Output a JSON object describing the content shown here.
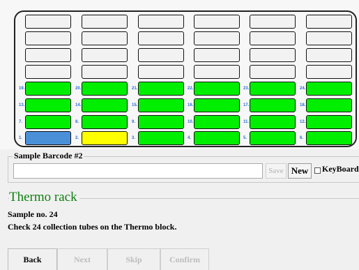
{
  "rack": {
    "slots": [
      {
        "num": "",
        "state": "empty"
      },
      {
        "num": "",
        "state": "empty"
      },
      {
        "num": "",
        "state": "empty"
      },
      {
        "num": "",
        "state": "empty"
      },
      {
        "num": "",
        "state": "empty"
      },
      {
        "num": "",
        "state": "empty"
      },
      {
        "num": "",
        "state": "empty"
      },
      {
        "num": "",
        "state": "empty"
      },
      {
        "num": "",
        "state": "empty"
      },
      {
        "num": "",
        "state": "empty"
      },
      {
        "num": "",
        "state": "empty"
      },
      {
        "num": "",
        "state": "empty"
      },
      {
        "num": "",
        "state": "empty"
      },
      {
        "num": "",
        "state": "empty"
      },
      {
        "num": "",
        "state": "empty"
      },
      {
        "num": "",
        "state": "empty"
      },
      {
        "num": "",
        "state": "empty"
      },
      {
        "num": "",
        "state": "empty"
      },
      {
        "num": "",
        "state": "empty"
      },
      {
        "num": "",
        "state": "empty"
      },
      {
        "num": "",
        "state": "empty"
      },
      {
        "num": "",
        "state": "empty"
      },
      {
        "num": "",
        "state": "empty"
      },
      {
        "num": "",
        "state": "empty"
      },
      {
        "num": "19.",
        "state": "green"
      },
      {
        "num": "20.",
        "state": "green"
      },
      {
        "num": "21.",
        "state": "green"
      },
      {
        "num": "22.",
        "state": "green"
      },
      {
        "num": "23.",
        "state": "green"
      },
      {
        "num": "24.",
        "state": "green"
      },
      {
        "num": "13.",
        "state": "green"
      },
      {
        "num": "14.",
        "state": "green"
      },
      {
        "num": "15.",
        "state": "green"
      },
      {
        "num": "16.",
        "state": "green"
      },
      {
        "num": "17.",
        "state": "green"
      },
      {
        "num": "18.",
        "state": "green"
      },
      {
        "num": "7.",
        "state": "green"
      },
      {
        "num": "8.",
        "state": "green"
      },
      {
        "num": "9.",
        "state": "green"
      },
      {
        "num": "10.",
        "state": "green"
      },
      {
        "num": "11.",
        "state": "green"
      },
      {
        "num": "12.",
        "state": "green"
      },
      {
        "num": "1.",
        "state": "blue"
      },
      {
        "num": "2.",
        "state": "yellow"
      },
      {
        "num": "3.",
        "state": "green"
      },
      {
        "num": "4.",
        "state": "green"
      },
      {
        "num": "5.",
        "state": "green"
      },
      {
        "num": "6.",
        "state": "green"
      }
    ],
    "colors": {
      "empty": "#f2f2f2",
      "green": "#00ee00",
      "blue": "#4a90d9",
      "yellow": "#ffff00"
    }
  },
  "barcode": {
    "label": "Sample Barcode #2",
    "value": "",
    "save_label": "Save",
    "new_label": "New",
    "keyboard_label": "KeyBoard",
    "keyboard_checked": false
  },
  "section": {
    "title": "Thermo rack",
    "sample_no": "Sample no. 24",
    "instruction": "Check 24 collection tubes on the Thermo block."
  },
  "nav": {
    "back": "Back",
    "next": "Next",
    "skip": "Skip",
    "confirm": "Confirm"
  }
}
